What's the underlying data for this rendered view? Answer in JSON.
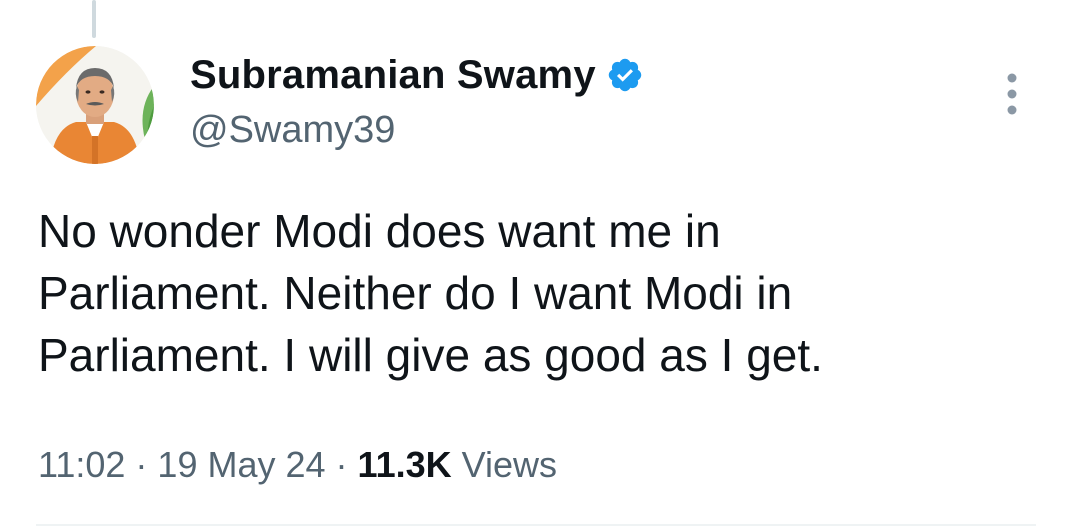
{
  "author": {
    "display_name": "Subramanian Swamy",
    "handle": "@Swamy39",
    "verified": true,
    "verified_color": "#1d9bf0"
  },
  "tweet": {
    "text_lines": [
      "No wonder Modi does want me in",
      "Parliament. Neither do I want Modi in",
      "Parliament. I will give as good as I get."
    ]
  },
  "meta": {
    "time": "11:02",
    "separator": " · ",
    "date": "19 May 24",
    "views_count": "11.3K",
    "views_label": "Views"
  },
  "icons": {
    "avatar": "profile-photo",
    "verified": "verified-badge-icon",
    "more": "more-options-icon"
  },
  "colors": {
    "text_primary": "#0f1419",
    "text_secondary": "#536471",
    "accent": "#1d9bf0"
  }
}
